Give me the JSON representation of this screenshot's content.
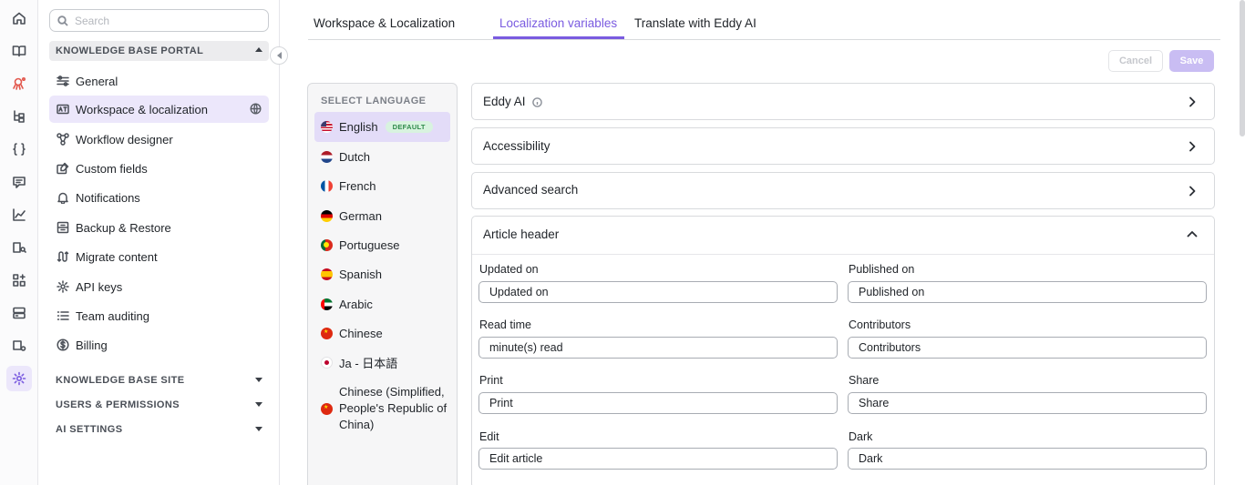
{
  "search": {
    "placeholder": "Search"
  },
  "sidebar": {
    "portal_heading": "KNOWLEDGE BASE PORTAL",
    "items": [
      {
        "label": "General",
        "icon": "sliders-icon"
      },
      {
        "label": "Workspace & localization",
        "icon": "translate-icon"
      },
      {
        "label": "Workflow designer",
        "icon": "workflow-icon"
      },
      {
        "label": "Custom fields",
        "icon": "custom-fields-icon"
      },
      {
        "label": "Notifications",
        "icon": "bell-icon"
      },
      {
        "label": "Backup & Restore",
        "icon": "backup-icon"
      },
      {
        "label": "Migrate content",
        "icon": "migrate-icon"
      },
      {
        "label": "API keys",
        "icon": "gear-icon"
      },
      {
        "label": "Team auditing",
        "icon": "list-icon"
      },
      {
        "label": "Billing",
        "icon": "dollar-icon"
      }
    ],
    "sections": [
      {
        "label": "KNOWLEDGE BASE SITE"
      },
      {
        "label": "USERS & PERMISSIONS"
      },
      {
        "label": "AI SETTINGS"
      }
    ]
  },
  "tabs": [
    {
      "label": "Workspace & Localization"
    },
    {
      "label": "Localization variables"
    },
    {
      "label": "Translate with Eddy AI"
    }
  ],
  "actions": {
    "cancel": "Cancel",
    "save": "Save"
  },
  "languages": {
    "title": "SELECT LANGUAGE",
    "default_badge": "DEFAULT",
    "items": [
      {
        "name": "English"
      },
      {
        "name": "Dutch"
      },
      {
        "name": "French"
      },
      {
        "name": "German"
      },
      {
        "name": "Portuguese"
      },
      {
        "name": "Spanish"
      },
      {
        "name": "Arabic"
      },
      {
        "name": "Chinese"
      },
      {
        "name": "Ja - 日本語"
      },
      {
        "name": "Chinese (Simplified, People's Republic of China)"
      }
    ]
  },
  "sections": [
    {
      "title": "Eddy AI"
    },
    {
      "title": "Accessibility"
    },
    {
      "title": "Advanced search"
    },
    {
      "title": "Article header"
    }
  ],
  "article_header": {
    "fields": [
      {
        "label": "Updated on",
        "value": "Updated on"
      },
      {
        "label": "Published on",
        "value": "Published on"
      },
      {
        "label": "Read time",
        "value": "minute(s) read"
      },
      {
        "label": "Contributors",
        "value": "Contributors"
      },
      {
        "label": "Print",
        "value": "Print"
      },
      {
        "label": "Share",
        "value": "Share"
      },
      {
        "label": "Edit",
        "value": "Edit article"
      },
      {
        "label": "Dark",
        "value": "Dark"
      }
    ]
  },
  "colors": {
    "accent": "#7a5be0",
    "accent_soft": "#ece7fb",
    "save_disabled": "#c9bdf3"
  }
}
